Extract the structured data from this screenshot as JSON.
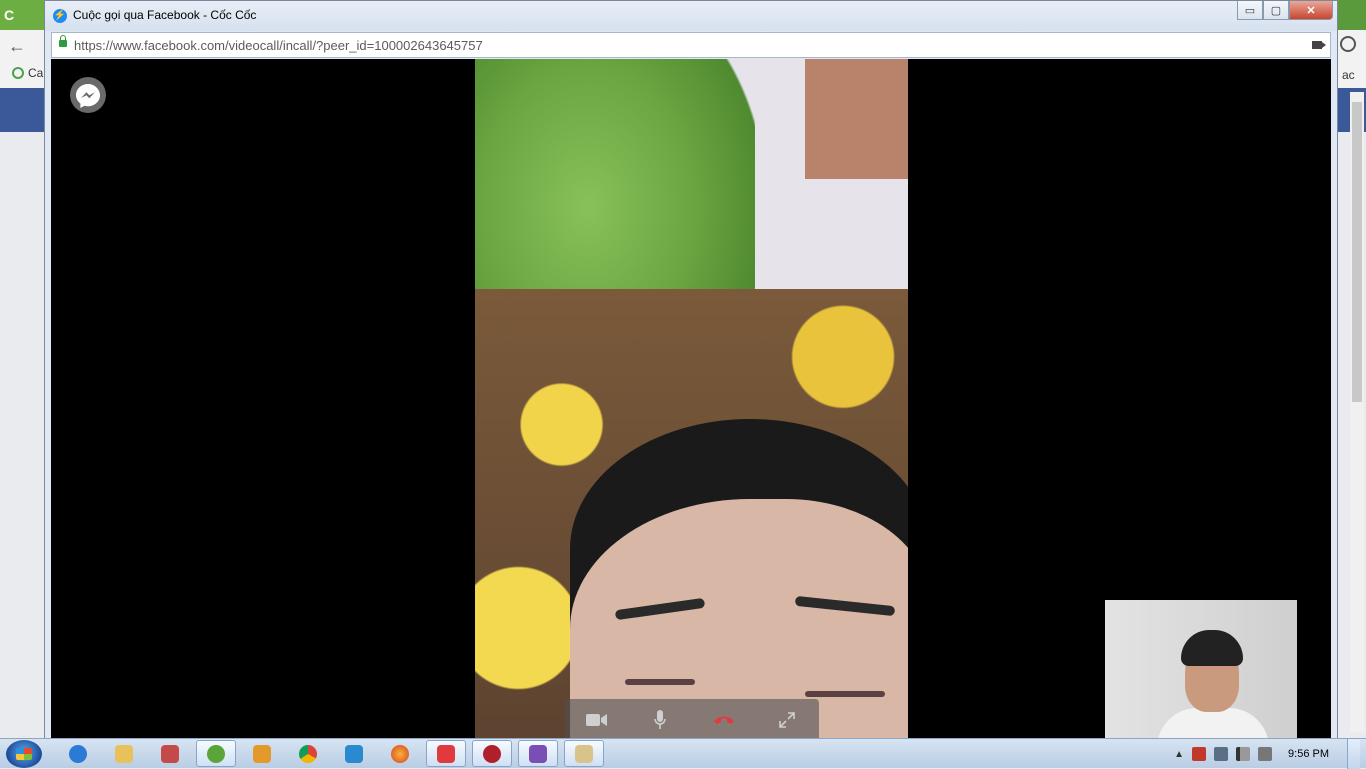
{
  "popup": {
    "title": "Cuộc gọi qua Facebook - Cốc Cốc",
    "url": "https://www.facebook.com/videocall/incall/?peer_id=100002643645757",
    "win_buttons": {
      "minimize": "▭",
      "maximize": "▢",
      "close": "✕"
    }
  },
  "background_browser": {
    "tab_text": "C",
    "bookmark_text": "Ca",
    "right_text": "ac"
  },
  "controls": {
    "camera": "camera-icon",
    "mic": "microphone-icon",
    "end_call": "end-call-icon",
    "fullscreen": "fullscreen-icon",
    "end_call_color": "#e0393e"
  },
  "taskbar": {
    "clock": "9:56 PM",
    "items": [
      "internet-explorer",
      "file-explorer",
      "network-app",
      "coccoc-browser",
      "media-player",
      "chrome",
      "app-icon",
      "firefox",
      "xmind",
      "app-red",
      "visual-studio",
      "tool-app"
    ]
  }
}
